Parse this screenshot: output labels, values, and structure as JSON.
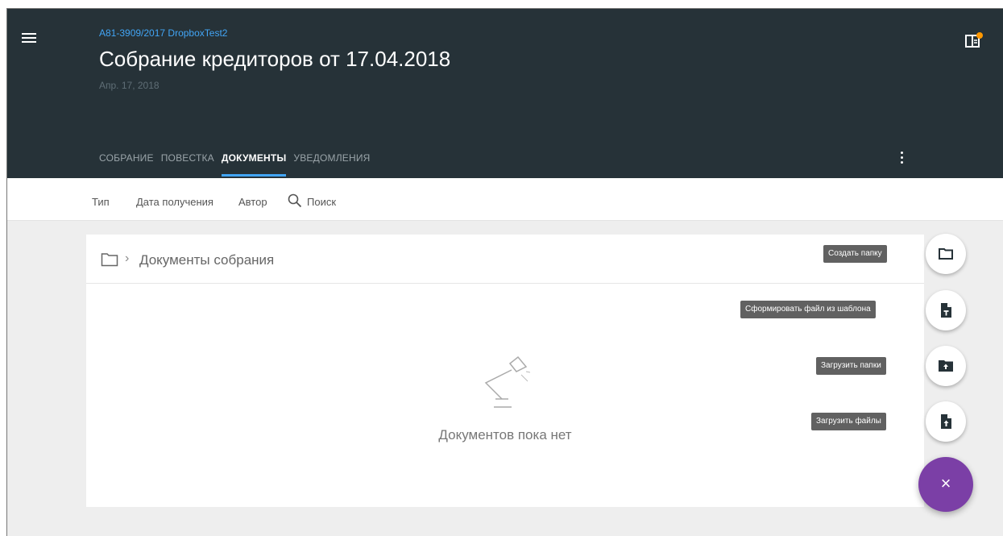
{
  "header": {
    "case_link": "А81-3909/2017 DropboxTest2",
    "title": "Собрание кредиторов от 17.04.2018",
    "date": "Апр. 17, 2018"
  },
  "tabs": [
    {
      "label": "СОБРАНИЕ",
      "active": false
    },
    {
      "label": "ПОВЕСТКА",
      "active": false
    },
    {
      "label": "ДОКУМЕНТЫ",
      "active": true
    },
    {
      "label": "УВЕДОМЛЕНИЯ",
      "active": false
    }
  ],
  "filters": {
    "type": "Тип",
    "date_received": "Дата получения",
    "author": "Автор",
    "search": "Поиск"
  },
  "breadcrumb": {
    "separator": "›",
    "label": "Документы собрания"
  },
  "empty_state": {
    "text": "Документов пока нет"
  },
  "actions": {
    "create_folder": "Создать папку",
    "from_template": "Сформировать файл из шаблона",
    "upload_folders": "Загрузить папки",
    "upload_files": "Загрузить файлы",
    "close_symbol": "×"
  },
  "colors": {
    "header_bg": "#263238",
    "accent": "#42a5f5",
    "fab": "#7b3fa6",
    "notification_dot": "#ff9800"
  }
}
